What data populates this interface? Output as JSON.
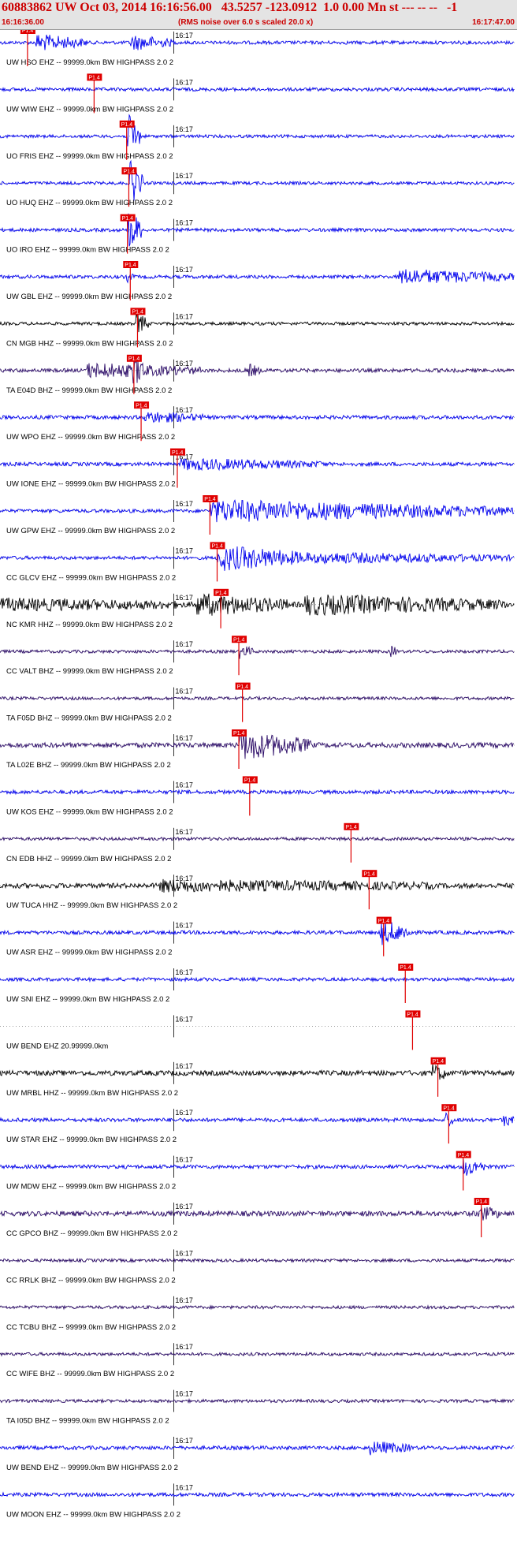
{
  "header": {
    "title": "60883862 UW Oct 03, 2014 16:16:56.00   43.5257 -123.0912  1.0 0.00 Mn st --- -- --   -1",
    "start_time": "16:16:36.00",
    "scale_note": "(RMS noise over 6.0 s scaled 20.0 x)",
    "end_time": "16:17:47.00"
  },
  "time_axis": {
    "start": "16:16:36.00",
    "end": "16:17:47.00",
    "duration_s": 71,
    "minute_tick": "16:17",
    "minute_tick_s": 24
  },
  "pick_marker_text": "P1.4",
  "colors": {
    "background": "#ffffff",
    "header_bg": "#e4e4e4",
    "title_red": "#cc0000",
    "pick_red": "#e00000",
    "blue_trace": "#0000ee",
    "black_trace": "#000000",
    "purple_trace": "#2a0a66",
    "grid_dot": "#666666"
  },
  "traces": [
    {
      "label": "UW HSO EHZ -- 99999.0km BW  HIGHPASS  2.0  2",
      "color": "blue",
      "pick_s": 3.8,
      "amp": 0.55,
      "bursts": [
        {
          "s": 5,
          "e": 12,
          "a": 2.4
        },
        {
          "s": 18,
          "e": 24,
          "a": 2.2
        }
      ]
    },
    {
      "label": "UW WIW EHZ -- 99999.0km BW  HIGHPASS  2.0  2",
      "color": "blue",
      "pick_s": 13.0,
      "amp": 0.55,
      "bursts": []
    },
    {
      "label": "UO FRIS EHZ -- 99999.0km BW  HIGHPASS  2.0  2",
      "color": "blue",
      "pick_s": 17.5,
      "amp": 0.5,
      "bursts": [
        {
          "s": 17.6,
          "e": 19.5,
          "a": 7
        }
      ]
    },
    {
      "label": "UO HUQ EHZ -- 99999.0km BW  HIGHPASS  2.0  2",
      "color": "blue",
      "pick_s": 17.8,
      "amp": 0.5,
      "bursts": [
        {
          "s": 17.9,
          "e": 19.8,
          "a": 7
        }
      ]
    },
    {
      "label": "UO IRO EHZ -- 99999.0km BW  HIGHPASS  2.0  2",
      "color": "blue",
      "pick_s": 17.6,
      "amp": 0.55,
      "bursts": [
        {
          "s": 17.7,
          "e": 19.6,
          "a": 7
        }
      ]
    },
    {
      "label": "UW GBL EHZ -- 99999.0km BW  HIGHPASS  2.0  2",
      "color": "blue",
      "pick_s": 18.0,
      "amp": 0.55,
      "bursts": [
        {
          "s": 17.5,
          "e": 18.5,
          "a": 1.4
        },
        {
          "s": 55,
          "e": 71,
          "a": 2.2
        }
      ]
    },
    {
      "label": "CN MGB HHZ -- 99999.0km BW  HIGHPASS  2.0  2",
      "color": "black",
      "pick_s": 19.0,
      "amp": 0.5,
      "bursts": [
        {
          "s": 18.8,
          "e": 20.5,
          "a": 3.5
        }
      ]
    },
    {
      "label": "TA E04D BHZ -- 99999.0km BW  HIGHPASS  2.0  2",
      "color": "purple",
      "pick_s": 18.5,
      "amp": 0.6,
      "bursts": [
        {
          "s": 12,
          "e": 28,
          "a": 2.0
        },
        {
          "s": 18.3,
          "e": 20,
          "a": 3.6
        },
        {
          "s": 34,
          "e": 36,
          "a": 2.0
        }
      ]
    },
    {
      "label": "UW WPO EHZ -- 99999.0km BW  HIGHPASS  2.0  2",
      "color": "blue",
      "pick_s": 19.5,
      "amp": 0.6,
      "bursts": [
        {
          "s": 20,
          "e": 28,
          "a": 1.5
        }
      ]
    },
    {
      "label": "UW IONE EHZ -- 99999.0km BW  HIGHPASS  2.0  2",
      "color": "blue",
      "pick_s": 24.5,
      "amp": 0.6,
      "bursts": [
        {
          "s": 25,
          "e": 45,
          "a": 1.5
        }
      ]
    },
    {
      "label": "UW GPW EHZ -- 99999.0km BW  HIGHPASS  2.0  2",
      "color": "blue",
      "pick_s": 29.0,
      "amp": 0.55,
      "bursts": [
        {
          "s": 29,
          "e": 71,
          "a": 3.2
        }
      ]
    },
    {
      "label": "CC GLCV EHZ -- 99999.0km BW  HIGHPASS  2.0  2",
      "color": "blue",
      "pick_s": 30.0,
      "amp": 0.55,
      "bursts": [
        {
          "s": 30,
          "e": 44,
          "a": 3.8
        },
        {
          "s": 44,
          "e": 71,
          "a": 1.4
        }
      ]
    },
    {
      "label": "NC KMR HHZ -- 99999.0km BW  HIGHPASS  2.0  2",
      "color": "black",
      "pick_s": 30.5,
      "amp": 0.9,
      "bursts": [
        {
          "s": 0,
          "e": 25,
          "a": 1.4
        },
        {
          "s": 27,
          "e": 40,
          "a": 3
        },
        {
          "s": 42,
          "e": 70,
          "a": 2.6
        }
      ]
    },
    {
      "label": "CC VALT BHZ -- 99999.0km BW  HIGHPASS  2.0  2",
      "color": "purple",
      "pick_s": 33.0,
      "amp": 0.5,
      "bursts": [
        {
          "s": 33,
          "e": 35,
          "a": 2.0
        },
        {
          "s": 54,
          "e": 55,
          "a": 1.6
        }
      ]
    },
    {
      "label": "TA F05D BHZ -- 99999.0km BW  HIGHPASS  2.0  2",
      "color": "purple",
      "pick_s": 33.5,
      "amp": 0.5,
      "bursts": []
    },
    {
      "label": "TA L02E BHZ -- 99999.0km BW  HIGHPASS  2.0  2",
      "color": "purple",
      "pick_s": 33.0,
      "amp": 0.8,
      "bursts": [
        {
          "s": 33,
          "e": 43,
          "a": 4.2
        }
      ]
    },
    {
      "label": "UW KOS EHZ -- 99999.0km BW  HIGHPASS  2.0  2",
      "color": "blue",
      "pick_s": 34.5,
      "amp": 0.6,
      "bursts": []
    },
    {
      "label": "CN EDB HHZ -- 99999.0km BW  HIGHPASS  2.0  2",
      "color": "purple",
      "pick_s": 48.5,
      "amp": 0.5,
      "bursts": []
    },
    {
      "label": "UW TUCA HHZ -- 99999.0km BW  HIGHPASS  2.0  2",
      "color": "black",
      "pick_s": 51.0,
      "amp": 0.8,
      "bursts": [
        {
          "s": 22,
          "e": 60,
          "a": 1.4
        }
      ]
    },
    {
      "label": "UW ASR EHZ -- 99999.0km BW  HIGHPASS  2.0  2",
      "color": "blue",
      "pick_s": 53.0,
      "amp": 0.6,
      "bursts": [
        {
          "s": 52.5,
          "e": 57,
          "a": 3.6
        }
      ]
    },
    {
      "label": "UW SNI EHZ -- 99999.0km BW  HIGHPASS  2.0  2",
      "color": "blue",
      "pick_s": 56.0,
      "amp": 0.55,
      "bursts": []
    },
    {
      "label": "UW BEND EHZ 20.99999.0km",
      "color": "blue",
      "pick_s": 57.0,
      "amp": 0.0,
      "bursts": []
    },
    {
      "label": "UW MRBL HHZ -- 99999.0km BW  HIGHPASS  2.0  2",
      "color": "black",
      "pick_s": 60.5,
      "amp": 0.8,
      "bursts": [
        {
          "s": 59.5,
          "e": 62,
          "a": 2.4
        }
      ]
    },
    {
      "label": "UW STAR EHZ -- 99999.0km BW  HIGHPASS  2.0  2",
      "color": "blue",
      "pick_s": 62.0,
      "amp": 0.6,
      "bursts": [
        {
          "s": 61.5,
          "e": 63,
          "a": 2.0
        },
        {
          "s": 69.5,
          "e": 71,
          "a": 2.0
        }
      ]
    },
    {
      "label": "UW MDW EHZ -- 99999.0km BW  HIGHPASS  2.0  2",
      "color": "blue",
      "pick_s": 64.0,
      "amp": 0.6,
      "bursts": [
        {
          "s": 64,
          "e": 67,
          "a": 2.6
        }
      ]
    },
    {
      "label": "CC GPCO BHZ -- 99999.0km BW  HIGHPASS  2.0  2",
      "color": "purple",
      "pick_s": 66.5,
      "amp": 0.8,
      "bursts": [
        {
          "s": 66,
          "e": 69,
          "a": 2.0
        }
      ]
    },
    {
      "label": "CC RRLK BHZ -- 99999.0km BW  HIGHPASS  2.0  2",
      "color": "purple",
      "pick_s": null,
      "amp": 0.5,
      "bursts": []
    },
    {
      "label": "CC TCBU BHZ -- 99999.0km BW  HIGHPASS  2.0  2",
      "color": "purple",
      "pick_s": null,
      "amp": 0.5,
      "bursts": []
    },
    {
      "label": "CC WIFE BHZ -- 99999.0km BW  HIGHPASS  2.0  2",
      "color": "purple",
      "pick_s": null,
      "amp": 0.5,
      "bursts": []
    },
    {
      "label": "TA I05D BHZ -- 99999.0km BW  HIGHPASS  2.0  2",
      "color": "purple",
      "pick_s": null,
      "amp": 0.5,
      "bursts": []
    },
    {
      "label": "UW BEND EHZ -- 99999.0km BW  HIGHPASS  2.0  2",
      "color": "blue",
      "pick_s": null,
      "amp": 0.6,
      "bursts": [
        {
          "s": 51,
          "e": 57,
          "a": 1.8
        }
      ]
    },
    {
      "label": "UW MOON EHZ -- 99999.0km BW  HIGHPASS  2.0  2",
      "color": "blue",
      "pick_s": null,
      "amp": 0.6,
      "bursts": []
    }
  ]
}
